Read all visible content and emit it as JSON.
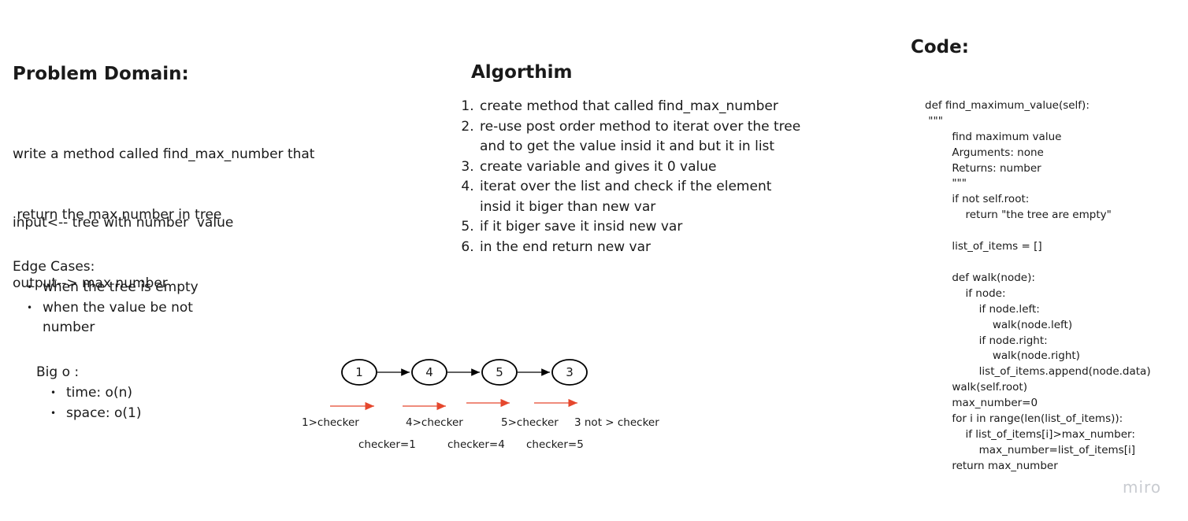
{
  "problem_domain": {
    "title": "Problem Domain:",
    "lines": [
      "write a method called find_max_number that",
      " return the max number in tree"
    ],
    "input": "input<-- tree with number  value",
    "output": "output--> max number",
    "edge_title": "Edge Cases:",
    "edge_cases": [
      "when the tree is empty",
      "when the value be not number"
    ],
    "big_o_title": "Big o :",
    "big_o": [
      "time: o(n)",
      "space: o(1)"
    ]
  },
  "algorithm": {
    "title": "Algorthim",
    "steps": [
      "create method that called  find_max_number",
      "re-use post order method to iterat over the tree and to get the value insid it and but it in list",
      "create variable and gives it 0 value",
      "iterat over the list and check if the element insid it biger than new var",
      "if it biger save it insid new var",
      "in the end return new var"
    ]
  },
  "diagram": {
    "nodes": [
      "1",
      "4",
      "5",
      "3"
    ],
    "checks": [
      "1>checker",
      "4>checker",
      "5>checker",
      "3 not > checker"
    ],
    "values": [
      "checker=1",
      "checker=4",
      "checker=5"
    ],
    "node_color": "#000000",
    "arrow_color": "#e5472d"
  },
  "code": {
    "title": "Code:",
    "lines": [
      "def find_maximum_value(self):",
      " \"\"\"",
      "        find maximum value",
      "        Arguments: none",
      "        Returns: number",
      "        \"\"\"",
      "        if not self.root:",
      "            return \"the tree are empty\"",
      "",
      "        list_of_items = []",
      "",
      "        def walk(node):",
      "            if node:",
      "                if node.left:",
      "                    walk(node.left)",
      "                if node.right:",
      "                    walk(node.right)",
      "                list_of_items.append(node.data)",
      "        walk(self.root)",
      "        max_number=0",
      "        for i in range(len(list_of_items)):",
      "            if list_of_items[i]>max_number:",
      "                max_number=list_of_items[i]",
      "        return max_number"
    ]
  },
  "brand": "miro"
}
